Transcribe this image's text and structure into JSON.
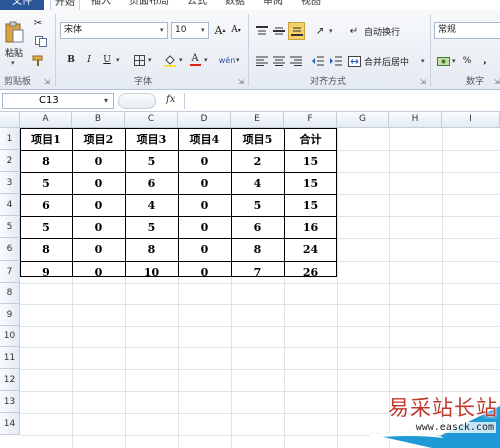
{
  "menu": {
    "file": "文件",
    "tabs": [
      "开始",
      "插入",
      "页面布局",
      "公式",
      "数据",
      "审阅",
      "视图"
    ]
  },
  "ribbon": {
    "clipboard": {
      "paste_label": "粘贴",
      "group_label": "剪贴板"
    },
    "font": {
      "name": "宋体",
      "size": "10",
      "group_label": "字体",
      "bold": "B",
      "italic": "I",
      "underline": "U",
      "grow": "A",
      "shrink": "A",
      "phonetic": "wén"
    },
    "alignment": {
      "wrap_label": "自动换行",
      "merge_label": "合并后居中",
      "group_label": "对齐方式"
    },
    "number": {
      "format": "常规",
      "percent": "%",
      "comma": ",",
      "group_label": "数字"
    }
  },
  "formula_bar": {
    "cell_ref": "C13",
    "fx": "fx",
    "content": ""
  },
  "columns": [
    "A",
    "B",
    "C",
    "D",
    "E",
    "F",
    "G",
    "H",
    "I"
  ],
  "rows": [
    "1",
    "2",
    "3",
    "4",
    "5",
    "6",
    "7",
    "8",
    "9",
    "10",
    "11",
    "12",
    "13",
    "14"
  ],
  "table": {
    "headers": [
      "项目1",
      "项目2",
      "项目3",
      "项目4",
      "项目5",
      "合计"
    ],
    "data": [
      [
        "8",
        "0",
        "5",
        "0",
        "2",
        "15"
      ],
      [
        "5",
        "0",
        "6",
        "0",
        "4",
        "15"
      ],
      [
        "6",
        "0",
        "4",
        "0",
        "5",
        "15"
      ],
      [
        "5",
        "0",
        "5",
        "0",
        "6",
        "16"
      ],
      [
        "8",
        "0",
        "8",
        "0",
        "8",
        "24"
      ],
      [
        "9",
        "0",
        "10",
        "0",
        "7",
        "26"
      ]
    ]
  },
  "watermark": {
    "text": "易采站长站",
    "url": "www.easck.com"
  },
  "colors": {
    "file_tab": "#2a5699",
    "highlight": "#f5d269",
    "watermark_text": "#c0392b",
    "watermark_shape": "#1e9bd7"
  }
}
